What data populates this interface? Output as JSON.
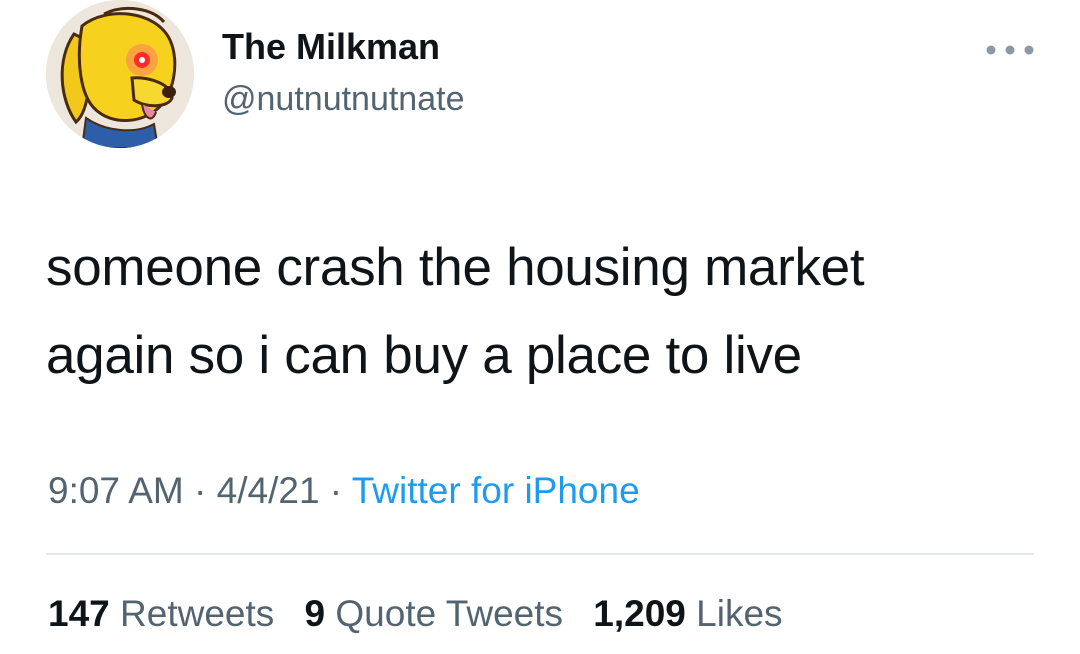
{
  "tweet": {
    "author": {
      "display_name": "The Milkman",
      "handle": "@nutnutnutnate",
      "avatar_icon": "cartoon-dog-laser-eyes-avatar"
    },
    "more_icon": "more-dots-icon",
    "text_line1": "someone crash the housing market",
    "text_line2": "again so i can buy a place to live",
    "time": "9:07 AM",
    "separator": " · ",
    "date": "4/4/21",
    "source": "Twitter for iPhone",
    "stats": {
      "retweets_count": "147",
      "retweets_label": "Retweets",
      "quotes_count": "9",
      "quotes_label": "Quote Tweets",
      "likes_count": "1,209",
      "likes_label": "Likes"
    },
    "colors": {
      "link_blue": "#1d9bf0",
      "secondary_gray": "#536471",
      "primary_text": "#0f1419",
      "divider": "#e1e8ed"
    }
  }
}
